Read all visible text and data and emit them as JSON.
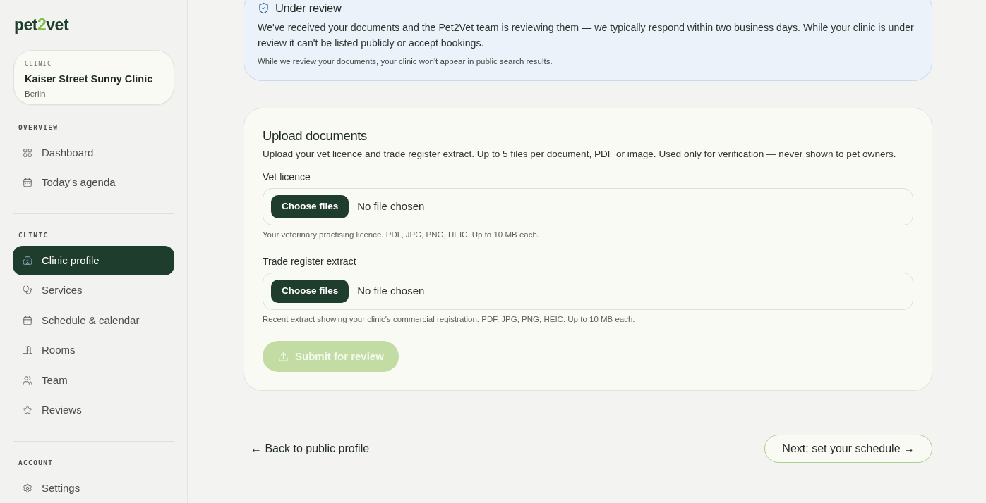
{
  "sidebar": {
    "logo": [
      {
        "text": "pet",
        "accent": false
      },
      {
        "text": "2",
        "accent": true
      },
      {
        "text": "vet",
        "accent": false
      }
    ],
    "clinic_card": {
      "label": "CLINIC",
      "name": "Kaiser Street Sunny Clinic",
      "city": "Berlin"
    },
    "sections": [
      {
        "heading": "OVERVIEW",
        "items": [
          {
            "label": "Dashboard",
            "selected": false
          },
          {
            "label": "Today's agenda",
            "selected": false
          }
        ]
      },
      {
        "heading": "CLINIC",
        "items": [
          {
            "label": "Clinic profile",
            "selected": true
          },
          {
            "label": "Services",
            "selected": false
          },
          {
            "label": "Schedule & calendar",
            "selected": false
          },
          {
            "label": "Rooms",
            "selected": false
          },
          {
            "label": "Team",
            "selected": false
          },
          {
            "label": "Reviews",
            "selected": false
          }
        ]
      },
      {
        "heading": "ACCOUNT",
        "items": [
          {
            "label": "Settings",
            "selected": false
          }
        ]
      }
    ]
  },
  "review_notice": {
    "title": "Under review",
    "body": "We've received your documents and the Pet2Vet team is reviewing them — we typically respond within two business days. While your clinic is under review it can't be listed publicly or accept bookings.",
    "note": "While we review your documents, your clinic won't appear in public search results."
  },
  "upload": {
    "title": "Upload documents",
    "description": "Upload your vet licence and trade register extract. Up to 5 files per document, PDF or image. Used only for verification — never shown to pet owners.",
    "fields": [
      {
        "label": "Vet licence",
        "button": "Choose files",
        "status": "No file chosen",
        "hint": "Your veterinary practising licence. PDF, JPG, PNG, HEIC. Up to 10 MB each."
      },
      {
        "label": "Trade register extract",
        "button": "Choose files",
        "status": "No file chosen",
        "hint": "Recent extract showing your clinic's commercial registration. PDF, JPG, PNG, HEIC. Up to 10 MB each."
      }
    ],
    "submit": {
      "label": "Submit for review",
      "disabled": true
    }
  },
  "footer": {
    "back": "← Back to public profile",
    "next": "Next: set your schedule →"
  }
}
